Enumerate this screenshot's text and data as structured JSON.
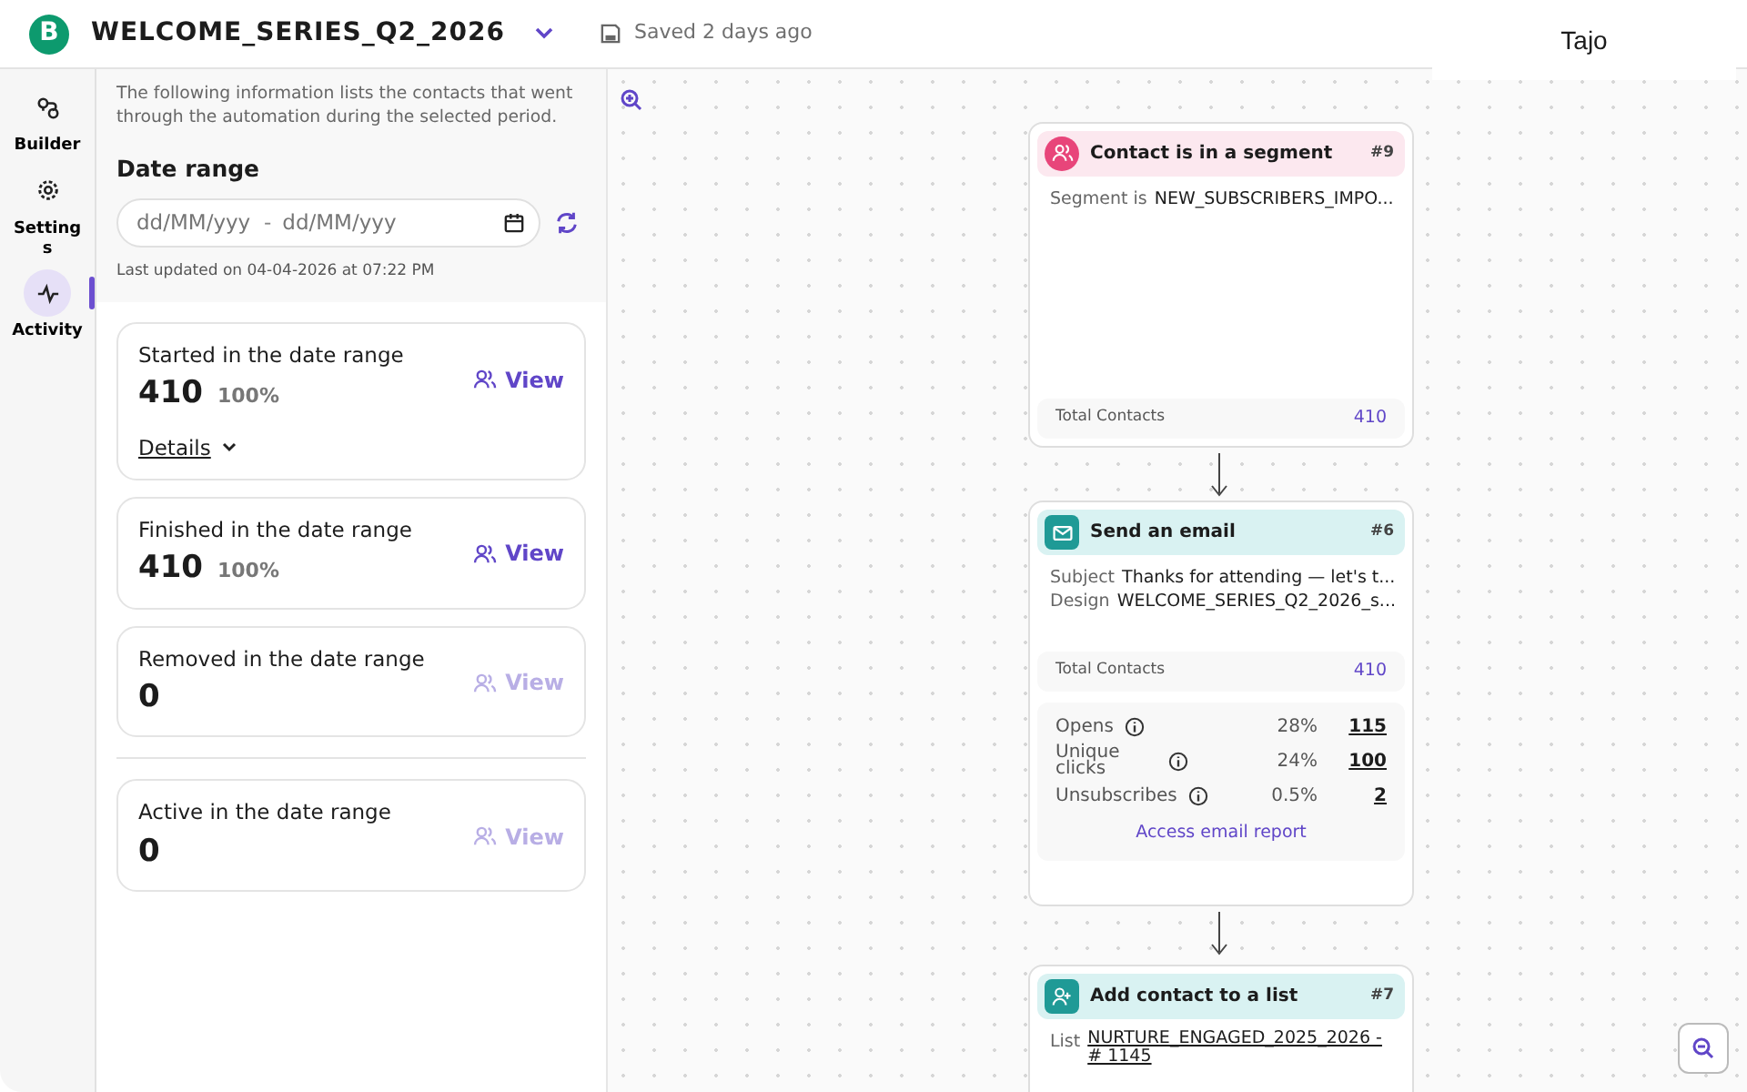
{
  "header": {
    "logo": "B",
    "title": "WELCOME_SERIES_Q2_2026",
    "save_status": "Saved 2 days ago"
  },
  "rail": [
    {
      "label": "Builder",
      "selected": false
    },
    {
      "label": "Settings",
      "selected": false
    },
    {
      "label": "Activity",
      "selected": true
    }
  ],
  "panel": {
    "intro": "The following information lists the contacts that went through the automation during the selected period.",
    "date_range_label": "Date range",
    "start_placeholder": "dd/MM/yyy",
    "end_placeholder": "dd/MM/yyy",
    "separator": "-",
    "last_updated": "Last updated on 04-04-2026 at 07:22 PM",
    "stats": [
      {
        "label": "Started in the date range",
        "count": "410",
        "percent": "100%",
        "view": "View",
        "disabled": false,
        "details": "Details"
      },
      {
        "label": "Finished in the date range",
        "count": "410",
        "percent": "100%",
        "view": "View",
        "disabled": false
      },
      {
        "label": "Removed in the date range",
        "count": "0",
        "view": "View",
        "disabled": true
      },
      {
        "label": "Active in the date range",
        "count": "0",
        "view": "View",
        "disabled": true
      }
    ]
  },
  "canvas": {
    "tooltip": "Tajo",
    "nodes": [
      {
        "kind": "segment",
        "title": "Contact is in a segment",
        "number": "#9",
        "color": "#e8457a",
        "fields": [
          {
            "label": "Segment is",
            "value": "NEW_SUBSCRIBERS_IMPO..."
          }
        ],
        "total": {
          "label": "Total Contacts",
          "value": "410"
        }
      },
      {
        "kind": "email",
        "title": "Send an email",
        "number": "#6",
        "color": "#1f9a96",
        "fields": [
          {
            "label": "Subject",
            "value": "Thanks for attending — let's t..."
          },
          {
            "label": "Design",
            "value": "WELCOME_SERIES_Q2_2026_s..."
          }
        ],
        "total": {
          "label": "Total Contacts",
          "value": "410"
        },
        "metrics": [
          {
            "label": "Opens",
            "percent": "28%",
            "count": "115"
          },
          {
            "label": "Unique clicks",
            "percent": "24%",
            "count": "100"
          },
          {
            "label": "Unsubscribes",
            "percent": "0.5%",
            "count": "2"
          }
        ],
        "report_link": "Access email report"
      },
      {
        "kind": "list",
        "title": "Add contact to a list",
        "number": "#7",
        "color": "#1f9a96",
        "fields": [
          {
            "label": "List",
            "value": "NURTURE_ENGAGED_2025_2026 - # 1145"
          }
        ]
      }
    ]
  }
}
